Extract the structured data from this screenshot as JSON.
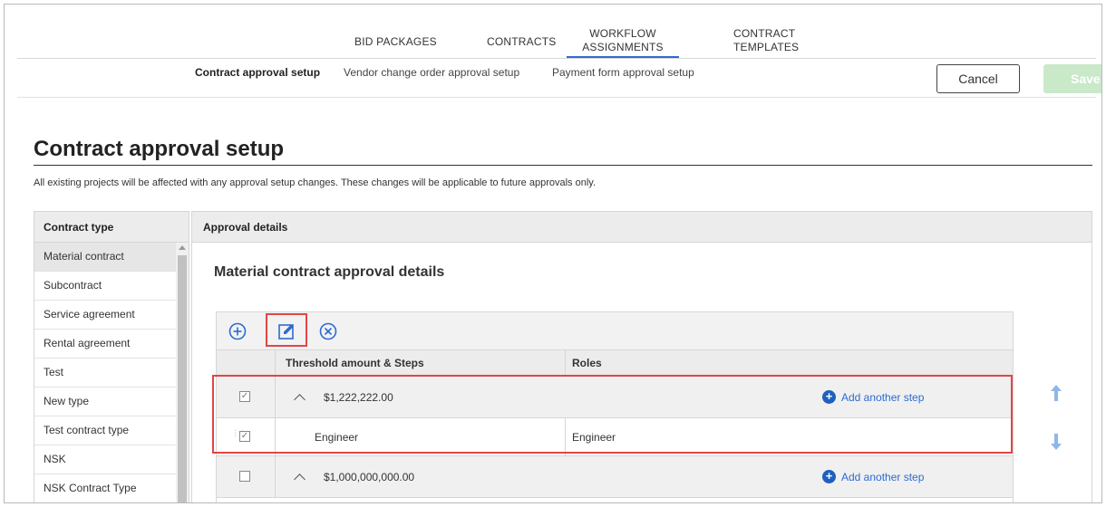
{
  "nav": {
    "tabs": [
      {
        "label": "BID PACKAGES"
      },
      {
        "label": "CONTRACTS"
      },
      {
        "label": "WORKFLOW\nASSIGNMENTS"
      },
      {
        "label": "CONTRACT\nTEMPLATES"
      }
    ],
    "active_tab": "WORKFLOW ASSIGNMENTS"
  },
  "subnav": {
    "items": [
      {
        "label": "Contract approval setup"
      },
      {
        "label": "Vendor change order approval setup"
      },
      {
        "label": "Payment form approval setup"
      }
    ],
    "active": "Contract approval setup"
  },
  "actions": {
    "cancel_label": "Cancel",
    "save_label": "Save"
  },
  "page": {
    "title": "Contract approval setup",
    "notice": "All existing projects will be affected with any approval setup changes. These changes will be applicable to future approvals only."
  },
  "contract_types": {
    "header": "Contract type",
    "items": [
      {
        "label": "Material contract"
      },
      {
        "label": "Subcontract"
      },
      {
        "label": "Service agreement"
      },
      {
        "label": "Rental agreement"
      },
      {
        "label": "Test"
      },
      {
        "label": "New type"
      },
      {
        "label": "Test contract type"
      },
      {
        "label": "NSK"
      },
      {
        "label": "NSK Contract Type"
      }
    ],
    "selected": "Material contract"
  },
  "approval": {
    "header": "Approval details",
    "title": "Material contract approval details",
    "columns": {
      "threshold": "Threshold amount & Steps",
      "roles": "Roles"
    },
    "rows": [
      {
        "type": "group",
        "checked": true,
        "amount": "$1,222,222.00",
        "add_step": "Add another step"
      },
      {
        "type": "step",
        "checked": true,
        "step": "Engineer",
        "role": "Engineer"
      },
      {
        "type": "group",
        "checked": false,
        "amount": "$1,000,000,000.00",
        "add_step": "Add another step"
      }
    ]
  },
  "colors": {
    "accent": "#2d6bcf",
    "highlight": "#e04646",
    "save_disabled": "#c9e9c9",
    "arrow": "#8fb6e8"
  }
}
